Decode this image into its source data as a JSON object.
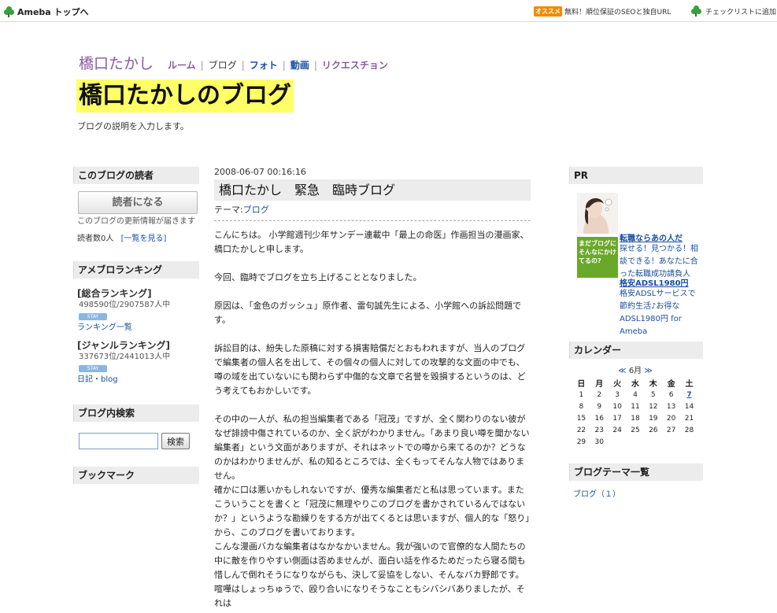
{
  "topbar": {
    "home_label": "Ameba トップへ",
    "promo_badge": "オススメ",
    "promo_text": "無料！順位保証のSEOと独自URL",
    "checklist_label": "チェックリストに追加"
  },
  "header": {
    "author_name": "橋口たかし",
    "nav": [
      "ルーム",
      "ブログ",
      "フォト",
      "動画",
      "リクエスチョン"
    ],
    "blog_title": "橋口たかしのブログ",
    "description": "ブログの説明を入力します。"
  },
  "left": {
    "readers_heading": "このブログの読者",
    "reader_button": "読者になる",
    "reader_note": "このブログの更新情報が届きます",
    "reader_count": "読者数0人",
    "reader_list_link": "[一覧を見る]",
    "ranking_heading": "アメブロランキング",
    "total_ranking_label": "[総合ランキング]",
    "total_ranking_value": "498590位/2907587人中",
    "stay_label": "STAY",
    "ranking_list_link": "ランキング一覧",
    "genre_ranking_label": "[ジャンルランキング]",
    "genre_ranking_value": "337673位/2441013人中",
    "genre_link": "日記・blog",
    "search_heading": "ブログ内検索",
    "search_value": "",
    "search_button": "検索",
    "bookmark_heading": "ブックマーク"
  },
  "post": {
    "date": "2008-06-07 00:16:16",
    "title": "橋口たかし　緊急　臨時ブログ",
    "theme_label": "テーマ:",
    "theme_link": "ブログ",
    "paragraphs": [
      "こんにちは。 小学館週刊少年サンデー連載中「最上の命医」作画担当の漫画家、橋口たかしと申します。",
      "今回、臨時でブログを立ち上げることとなりました。",
      "原因は、「金色のガッシュ」原作者、雷句誠先生による、小学館への訴訟問題です。",
      "訴訟目的は、紛失した原稿に対する損害賠償だとおもわれますが、当人のブログで編集者の個人名を出して、その個々の個人に対しての攻撃的な文面の中でも、噂の域を出ていないにも関わらず中傷的な文章で名誉を毀損するというのは、どう考えてもおかしいです。",
      "その中の一人が、私の担当編集者である「冠茂」ですが、全く関わりのない彼がなぜ誹謗中傷されているのか、全く訳がわかりません。「あまり良い噂を聞かない編集者」という文面がありますが、それはネットでの噂から来てるのか？どうなのかはわかりませんが、私の知るところでは、全くもってそんな人物ではありません。",
      "確かに口は悪いかもしれないですが、優秀な編集者だと私は思っています。またこういうことを書くと「冠茂に無理やりこのブログを書かされているんではないか？」というような勘繰りをする方が出てくるとは思いますが、個人的な「怒り」から、このブログを書いております。",
      "こんな漫画バカな編集者はなかなかいません。我が強いので官僚的な人間たちの中に敵を作りやすい側面は否めませんが、面白い話を作るためだったら寝る間も惜しんで倒れそうになりながらも、決して妥協をしない、そんなバカ野郎です。",
      "喧嘩はしょっちゅうで、殴り合いになりそうなこともシバシバありましたが、それは"
    ]
  },
  "right": {
    "pr_heading": "PR",
    "pr_items": [
      {
        "title": "転職ならあの人だ",
        "desc": "探せる！見つかる！相談できる！あなたに合った転職成功請負人",
        "image": "woman-portrait-image"
      },
      {
        "title": "格安ADSL1980円",
        "desc": "格安ADSLサービスで節約生活♪お得なADSL1980円 for Ameba",
        "image": "blog-ad-banner",
        "image_text": "まだブログにそんなにかけてるの?"
      }
    ],
    "calendar_heading": "カレンダー",
    "calendar": {
      "prev": "≪",
      "month": "6月",
      "next": "≫",
      "weekdays": [
        "日",
        "月",
        "火",
        "水",
        "木",
        "金",
        "土"
      ],
      "weeks": [
        [
          "1",
          "2",
          "3",
          "4",
          "5",
          "6",
          "7"
        ],
        [
          "8",
          "9",
          "10",
          "11",
          "12",
          "13",
          "14"
        ],
        [
          "15",
          "16",
          "17",
          "18",
          "19",
          "20",
          "21"
        ],
        [
          "22",
          "23",
          "24",
          "25",
          "26",
          "27",
          "28"
        ],
        [
          "29",
          "30",
          "",
          "",
          "",
          "",
          ""
        ]
      ],
      "today": "7"
    },
    "themes_heading": "ブログテーマ一覧",
    "theme_item": "ブログ（１）"
  },
  "colors": {
    "accent_purple": "#8b5aa0",
    "link_blue": "#1a4fa0",
    "title_highlight": "#ffff66",
    "heading_bg": "#ececec"
  }
}
